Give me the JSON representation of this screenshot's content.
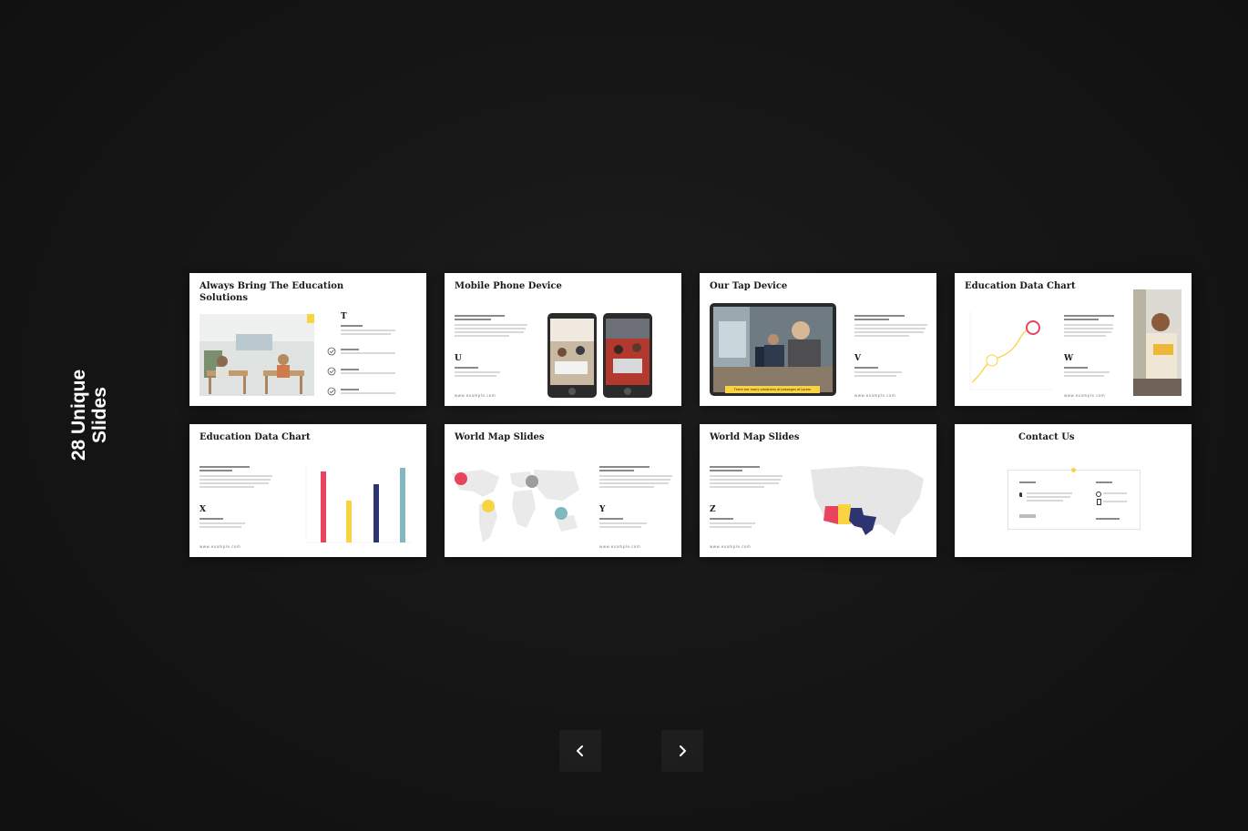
{
  "side_title": {
    "line1": "28 Unique",
    "line2": "Slides"
  },
  "slides": [
    {
      "title": "Always Bring The Education Solutions",
      "letter": "T"
    },
    {
      "title": "Mobile Phone Device",
      "letter": "U"
    },
    {
      "title": "Our Tap Device",
      "letter": "V",
      "banner": "There are many variations of passages of Lorem"
    },
    {
      "title": "Education Data Chart",
      "letter": "W"
    },
    {
      "title": "Education Data Chart",
      "letter": "X"
    },
    {
      "title": "World Map Slides",
      "letter": "Y"
    },
    {
      "title": "World Map Slides",
      "letter": "Z"
    },
    {
      "title": "Contact Us"
    }
  ],
  "navigation": {
    "prev_icon": "chevron-left-icon",
    "next_icon": "chevron-right-icon"
  },
  "colors": {
    "accent_yellow": "#f9d342",
    "accent_red": "#e8445f",
    "accent_navy": "#2d3470",
    "accent_teal": "#7fb8be",
    "background": "#151515"
  }
}
